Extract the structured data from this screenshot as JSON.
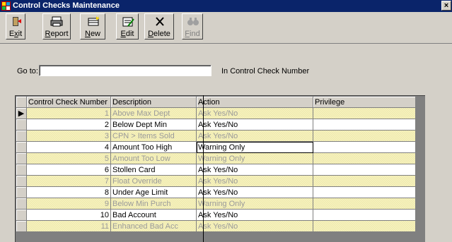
{
  "window": {
    "title": "Control Checks Maintenance",
    "close_glyph": "×"
  },
  "toolbar": {
    "buttons": [
      {
        "label_pre": "E",
        "label_ul": "x",
        "label_post": "it",
        "icon": "exit-door-icon"
      },
      {
        "label_pre": "",
        "label_ul": "R",
        "label_post": "eport",
        "icon": "printer-icon"
      },
      {
        "label_pre": "",
        "label_ul": "N",
        "label_post": "ew",
        "icon": "new-record-icon"
      },
      {
        "label_pre": "",
        "label_ul": "E",
        "label_post": "dit",
        "icon": "edit-record-icon"
      },
      {
        "label_pre": "",
        "label_ul": "D",
        "label_post": "elete",
        "icon": "delete-x-icon"
      },
      {
        "label_pre": "",
        "label_ul": "F",
        "label_post": "ind",
        "icon": "binoculars-icon"
      }
    ]
  },
  "goto": {
    "label": "Go to:",
    "value": "",
    "suffix": "In Control Check Number"
  },
  "table": {
    "headers": [
      "Control Check Number",
      "Description",
      "Action",
      "Privilege"
    ],
    "rows": [
      {
        "num": "1",
        "desc": "Above Max Dept",
        "action": "Ask Yes/No",
        "priv": "",
        "style": "alt",
        "current": true
      },
      {
        "num": "2",
        "desc": "Below Dept Min",
        "action": "Ask Yes/No",
        "priv": "",
        "style": "norm"
      },
      {
        "num": "3",
        "desc": "CPN > Items Sold",
        "action": "Ask Yes/No",
        "priv": "",
        "style": "alt"
      },
      {
        "num": "4",
        "desc": "Amount Too High",
        "action": "Warning Only",
        "priv": "",
        "style": "norm",
        "focus": true
      },
      {
        "num": "5",
        "desc": "Amount Too Low",
        "action": "Warning Only",
        "priv": "",
        "style": "alt"
      },
      {
        "num": "6",
        "desc": "Stollen Card",
        "action": "Ask Yes/No",
        "priv": "",
        "style": "norm"
      },
      {
        "num": "7",
        "desc": "Float Override",
        "action": "Ask Yes/No",
        "priv": "",
        "style": "alt"
      },
      {
        "num": "8",
        "desc": "Under Age Limit",
        "action": "Ask Yes/No",
        "priv": "",
        "style": "norm"
      },
      {
        "num": "9",
        "desc": "Below Min Purch",
        "action": "Warning Only",
        "priv": "",
        "style": "alt"
      },
      {
        "num": "10",
        "desc": "Bad Account",
        "action": "Ask Yes/No",
        "priv": "",
        "style": "norm"
      },
      {
        "num": "11",
        "desc": "Enhanced Bad Acc",
        "action": "Ask Yes/No",
        "priv": "",
        "style": "alt"
      }
    ],
    "row_pointer": "▶"
  }
}
